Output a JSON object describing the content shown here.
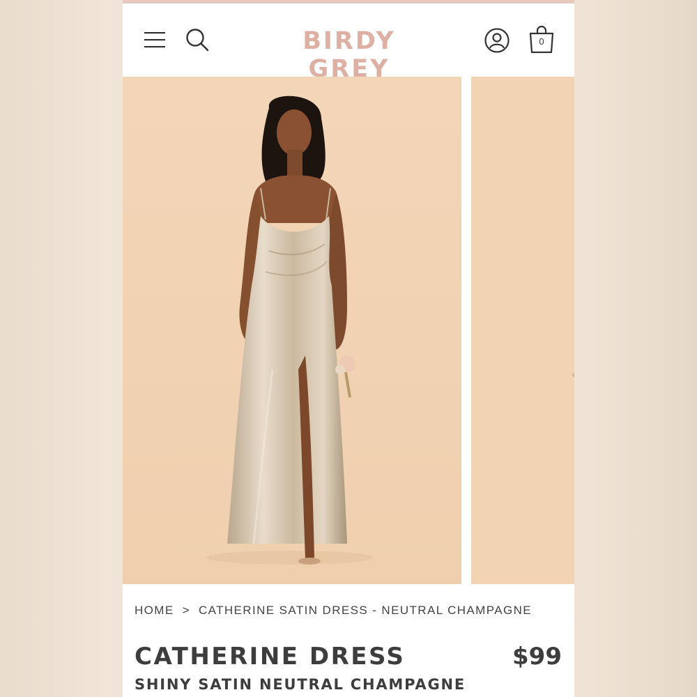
{
  "header": {
    "brand": "BIRDY GREY",
    "menu_icon": "hamburger-menu-icon",
    "search_icon": "search-icon",
    "account_icon": "account-icon",
    "cart_icon": "shopping-bag-icon",
    "cart_count": "0"
  },
  "gallery": {
    "slides": [
      {
        "description_icon": "product-photo-model-dress"
      },
      {
        "description_icon": "product-photo-next"
      }
    ]
  },
  "breadcrumb": {
    "home": "HOME",
    "separator": ">",
    "current": "CATHERINE SATIN DRESS - NEUTRAL CHAMPAGNE"
  },
  "product": {
    "title": "CATHERINE DRESS",
    "price": "$99",
    "subtitle": "SHINY SATIN NEUTRAL CHAMPAGNE"
  },
  "colors": {
    "brand": "#ddb0a3",
    "backdrop": "#f2d3b3",
    "text": "#3d3d3d",
    "dress": "#d4c4ad"
  }
}
